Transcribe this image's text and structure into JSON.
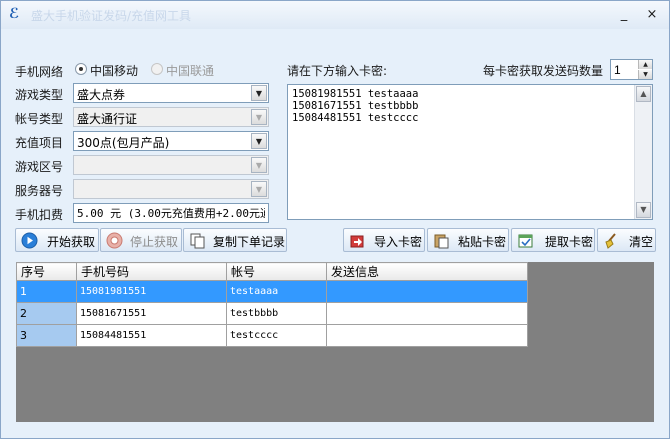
{
  "window": {
    "title": "盛大手机验证发码/充值网工具",
    "minimize": "_",
    "close": "×"
  },
  "form": {
    "network_label": "手机网络",
    "network_options": [
      "中国移动",
      "中国联通"
    ],
    "game_type_label": "游戏类型",
    "game_type_value": "盛大点券",
    "account_type_label": "帐号类型",
    "account_type_value": "盛大通行证",
    "recharge_label": "充值项目",
    "recharge_value": "300点(包月产品)",
    "zone_label": "游戏区号",
    "zone_value": "",
    "server_label": "服务器号",
    "server_value": "",
    "fee_label": "手机扣费",
    "fee_value": "5.00 元 (3.00元充值费用+2.00元通"
  },
  "cards": {
    "prompt": "请在下方输入卡密:",
    "count_label": "每卡密获取发送码数量",
    "count_value": "1",
    "text": "15081981551 testaaaa\n15081671551 testbbbb\n15084481551 testcccc"
  },
  "toolbar": {
    "start": "开始获取",
    "stop": "停止获取",
    "copy": "复制下单记录",
    "import": "导入卡密",
    "paste": "粘贴卡密",
    "extract": "提取卡密",
    "clear": "清空"
  },
  "table": {
    "headers": [
      "序号",
      "手机号码",
      "帐号",
      "发送信息"
    ],
    "rows": [
      [
        "1",
        "15081981551",
        "testaaaa",
        ""
      ],
      [
        "2",
        "15081671551",
        "testbbbb",
        ""
      ],
      [
        "3",
        "15084481551",
        "testcccc",
        ""
      ]
    ]
  },
  "colors": {
    "selection": "#3399ff",
    "rownum_bg": "#a6caf0",
    "grid_bg": "#808080"
  }
}
